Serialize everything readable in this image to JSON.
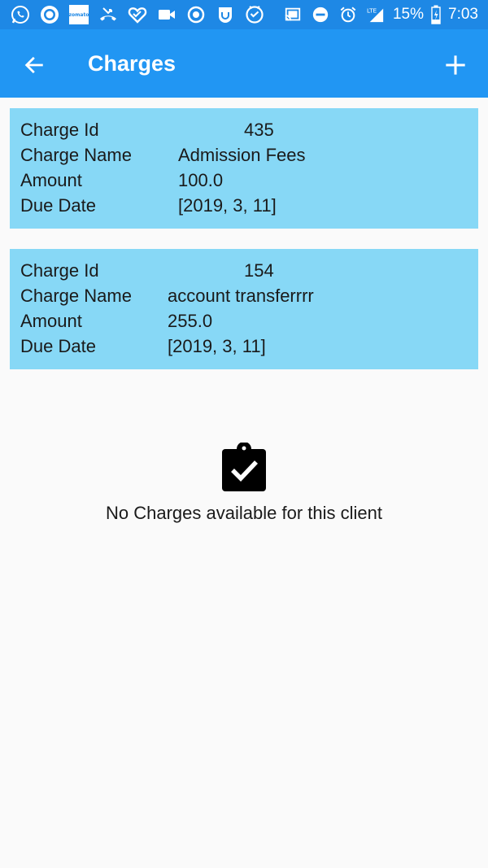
{
  "status_bar": {
    "icons": [
      "whatsapp-icon",
      "camera-app-icon",
      "zomato-icon",
      "missed-call-icon",
      "heart-app-icon",
      "video-icon",
      "record-icon",
      "app-badge-icon",
      "check-app-icon",
      "cast-icon",
      "dnd-icon",
      "alarm-icon",
      "lte-signal-icon",
      "battery-icon"
    ],
    "zomato_text": "zomato",
    "lte": "LTE",
    "battery": "15%",
    "time": "7:03",
    "color": "#1e88e5"
  },
  "toolbar": {
    "title": "Charges",
    "back_icon": "arrow-left-icon",
    "add_icon": "plus-icon",
    "color": "#2196f3"
  },
  "charges": [
    {
      "id_label": "Charge Id",
      "id": "435",
      "name_label": "Charge Name",
      "name": "Admission Fees",
      "amount_label": "Amount",
      "amount": "100.0",
      "due_label": "Due Date",
      "due": "[2019, 3, 11]"
    },
    {
      "id_label": "Charge Id",
      "id": "154",
      "name_label": "Charge Name",
      "name": "account transferrrr",
      "amount_label": "Amount",
      "amount": "255.0",
      "due_label": "Due Date",
      "due": "[2019, 3, 11]"
    }
  ],
  "card_color": "#87d8f6",
  "empty_state": {
    "icon": "assignment-turned-in-icon",
    "message": "No Charges available for this client"
  }
}
